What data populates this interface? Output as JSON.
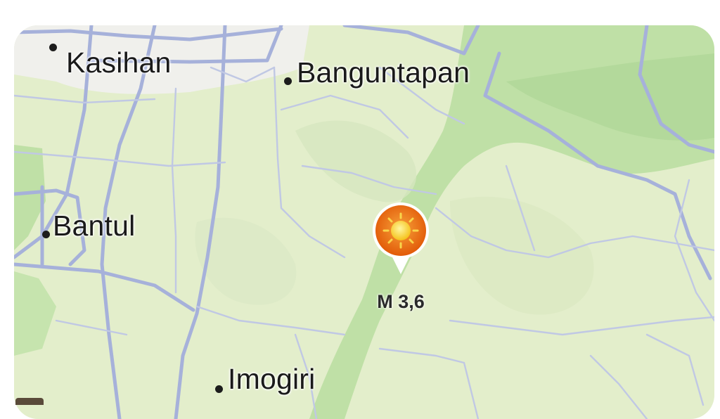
{
  "map": {
    "places": [
      {
        "name": "Kasihan"
      },
      {
        "name": "Banguntapan"
      },
      {
        "name": "Bantul"
      },
      {
        "name": "Imogiri"
      }
    ],
    "earthquake": {
      "magnitude_label": "M 3,6",
      "icon": "sun-icon",
      "pin_color": "#e8600a"
    },
    "colors": {
      "land": "#e3eecb",
      "forest": "#b9dca0",
      "urban": "#f1f1ee",
      "road": "#a7b2dc"
    }
  }
}
